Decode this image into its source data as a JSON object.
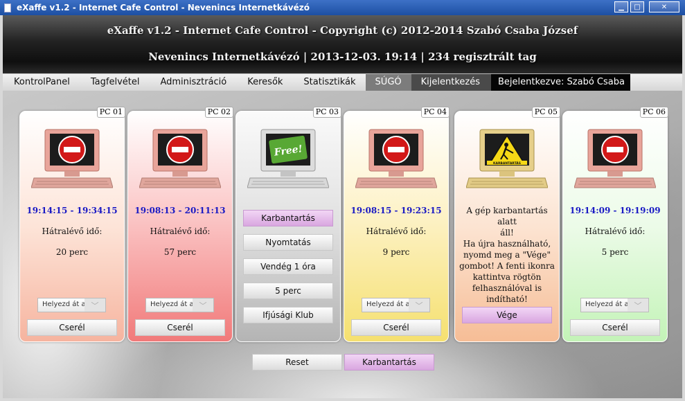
{
  "window": {
    "title": "eXaffe v1.2 - Internet Cafe Control - Nevenincs Internetkávézó"
  },
  "header": {
    "title": "eXaffe v1.2 - Internet Cafe Control - Copyright (c) 2012-2014 Szabó Csaba József",
    "subtitle": "Nevenincs Internetkávézó | 2013-12-03. 19:14 | 234 regisztrált tag"
  },
  "nav": {
    "items": [
      "KontrolPanel",
      "Tagfelvétel",
      "Adminisztráció",
      "Keresők",
      "Statisztikák"
    ],
    "help": "SÚGÓ",
    "logout": "Kijelentkezés",
    "user": "Bejelentkezve: Szabó Csaba"
  },
  "cards": [
    {
      "pc": "PC 01",
      "time": "19:14:15 - 19:34:15",
      "label": "Hátralévő idő:",
      "remaining": "20 perc",
      "move": "Helyezd át a...",
      "swap": "Cserél"
    },
    {
      "pc": "PC 02",
      "time": "19:08:13 - 20:11:13",
      "label": "Hátralévő idő:",
      "remaining": "57 perc",
      "move": "Helyezd át a...",
      "swap": "Cserél"
    },
    {
      "pc": "PC 03",
      "buttons": [
        "Karbantartás",
        "Nyomtatás",
        "Vendég 1 óra",
        "5 perc",
        "Ifjúsági Klub"
      ]
    },
    {
      "pc": "PC 04",
      "time": "19:08:15 - 19:23:15",
      "label": "Hátralévő idő:",
      "remaining": "9 perc",
      "move": "Helyezd át a...",
      "swap": "Cserél"
    },
    {
      "pc": "PC 05",
      "message_lines": [
        "A gép karbantartás alatt",
        "áll!",
        "Ha újra használható,",
        "nyomd meg a \"Vége\"",
        "gombot! A fenti ikonra",
        "kattintva rögtön",
        "felhasználóval is",
        "indítható!"
      ],
      "end_button": "Vége",
      "sign_text": "KARBANTARTÁS"
    },
    {
      "pc": "PC 06",
      "time": "19:14:09 - 19:19:09",
      "label": "Hátralévő idő:",
      "remaining": "5 perc",
      "move": "Helyezd át a...",
      "swap": "Cserél"
    }
  ],
  "free_label": "Free!",
  "bottom": {
    "reset": "Reset",
    "maintenance": "Karbantartás"
  },
  "colors": {
    "time_blue": "#1a1ac4",
    "maintenance_pink": "#d9a6e0",
    "stop_red": "#d21818"
  }
}
